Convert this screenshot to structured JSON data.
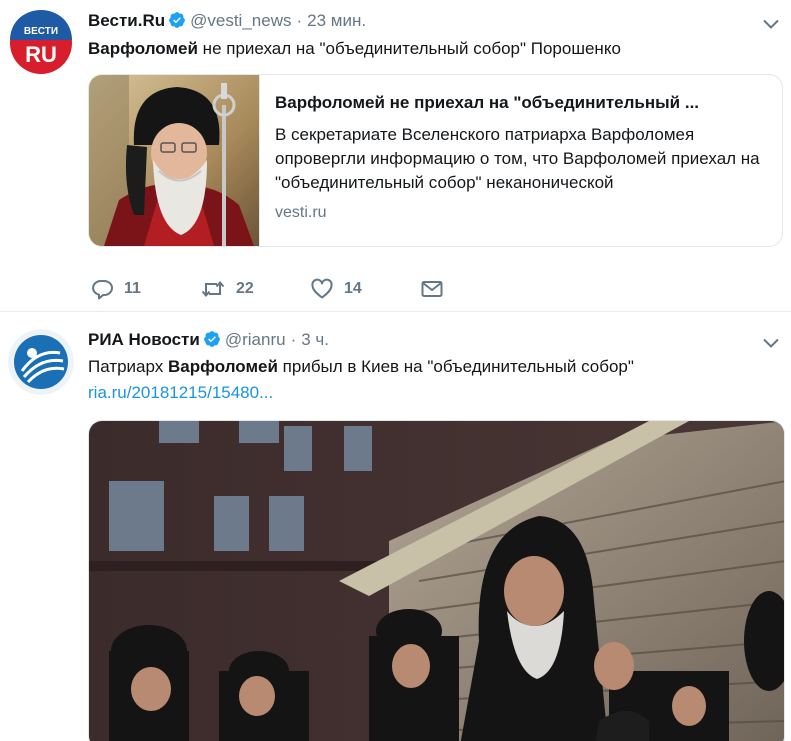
{
  "tweets": [
    {
      "avatar": {
        "line1": "ВЕСТИ",
        "line2": "RU"
      },
      "name": "Вести.Ru",
      "handle": "@vesti_news",
      "separator": "·",
      "time": "23 мин.",
      "text_bold": "Варфоломей",
      "text_rest": " не приехал на \"объединительный собор\" Порошенко",
      "card": {
        "title": "Варфоломей не приехал на \"объединительный ...",
        "description": "В секретариате Вселенского патриарха Варфоломея опровергли информацию о том, что Варфоломей приехал на \"объединительный собор\" неканонической",
        "domain": "vesti.ru"
      },
      "actions": {
        "replies": "11",
        "retweets": "22",
        "likes": "14"
      }
    },
    {
      "name": "РИА Новости",
      "handle": "@rianru",
      "separator": "·",
      "time": "3 ч.",
      "text_prefix": "Патриарх ",
      "text_bold": "Варфоломей",
      "text_rest": " прибыл в Киев на \"объединительный собор\"",
      "link": "ria.ru/20181215/15480..."
    }
  ],
  "colors": {
    "verified": "#1da1f2",
    "link": "#1b95e0",
    "muted": "#657786",
    "vesti_red": "#d81e2c",
    "ria_blue": "#1a6fb5"
  },
  "icons": [
    "verified-icon",
    "chevron-down-icon",
    "reply-icon",
    "retweet-icon",
    "like-icon",
    "direct-message-icon"
  ]
}
